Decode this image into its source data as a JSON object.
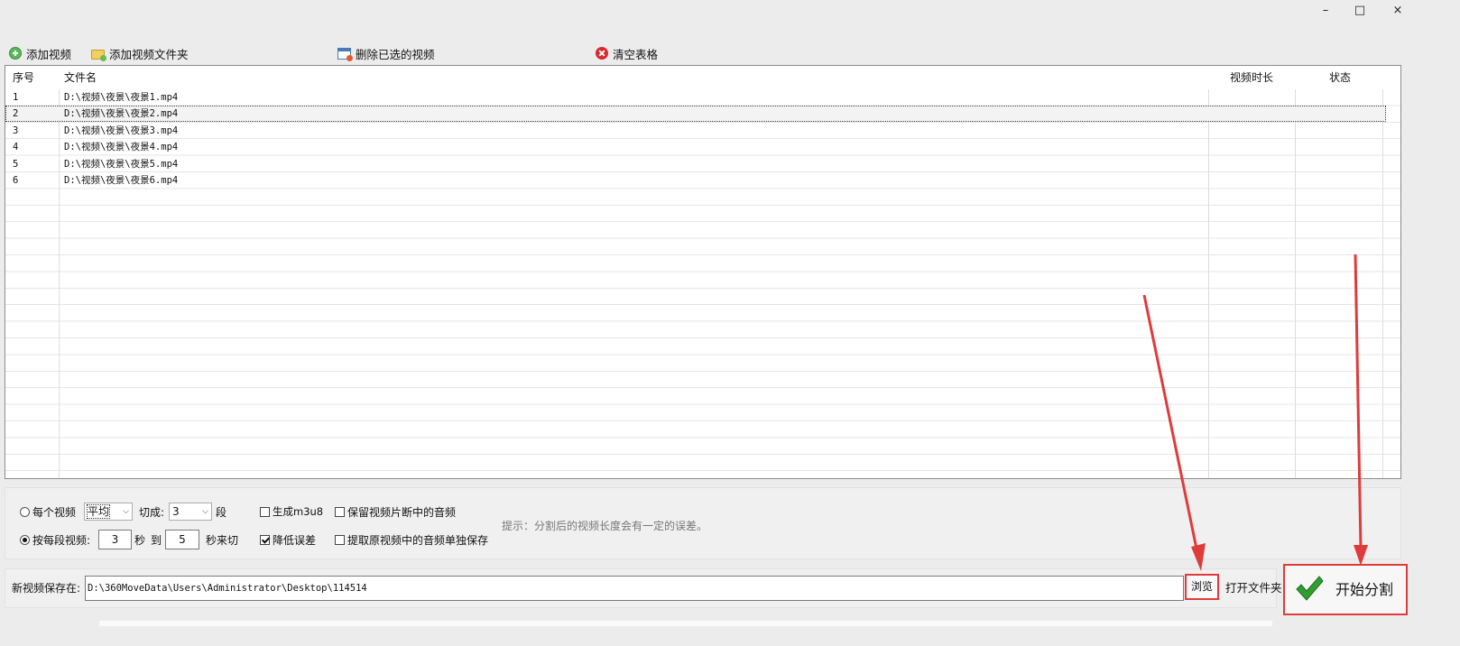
{
  "window": {
    "minimize": "–",
    "maximize": "□",
    "close": "×"
  },
  "toolbar": {
    "add_video": "添加视频",
    "add_folder": "添加视频文件夹",
    "delete_selected": "删除已选的视频",
    "clear_table": "清空表格"
  },
  "table": {
    "headers": {
      "index": "序号",
      "filename": "文件名",
      "duration": "视频时长",
      "status": "状态"
    },
    "rows": [
      {
        "index": "1",
        "filename": "D:\\视频\\夜景\\夜景1.mp4",
        "duration": "",
        "status": ""
      },
      {
        "index": "2",
        "filename": "D:\\视频\\夜景\\夜景2.mp4",
        "duration": "",
        "status": ""
      },
      {
        "index": "3",
        "filename": "D:\\视频\\夜景\\夜景3.mp4",
        "duration": "",
        "status": ""
      },
      {
        "index": "4",
        "filename": "D:\\视频\\夜景\\夜景4.mp4",
        "duration": "",
        "status": ""
      },
      {
        "index": "5",
        "filename": "D:\\视频\\夜景\\夜景5.mp4",
        "duration": "",
        "status": ""
      },
      {
        "index": "6",
        "filename": "D:\\视频\\夜景\\夜景6.mp4",
        "duration": "",
        "status": ""
      }
    ],
    "selected_row": 2
  },
  "options": {
    "each_video_label": "每个视频",
    "mode_select": "平均",
    "cut_into_label": "切成:",
    "segments_select": "3",
    "segments_unit": "段",
    "per_segment_label": "按每段视频:",
    "seconds_from": "3",
    "seconds_unit": "秒",
    "to_label": "到",
    "seconds_to": "5",
    "seconds_cut_label": "秒来切",
    "gen_m3u8": "生成m3u8",
    "keep_audio": "保留视频片断中的音频",
    "reduce_error": "降低误差",
    "extract_audio": "提取原视频中的音频单独保存",
    "hint": "提示：分割后的视频长度会有一定的误差。",
    "state": {
      "each_video": false,
      "per_segment": true,
      "gen_m3u8": false,
      "keep_audio": false,
      "reduce_error": true,
      "extract_audio": false
    }
  },
  "save": {
    "label": "新视频保存在:",
    "path": "D:\\360MoveData\\Users\\Administrator\\Desktop\\114514",
    "browse": "浏览",
    "open_folder": "打开文件夹"
  },
  "start": {
    "label": "开始分割"
  },
  "colors": {
    "annotation_red": "#e03b3b",
    "check_green": "#2f9e2f"
  }
}
